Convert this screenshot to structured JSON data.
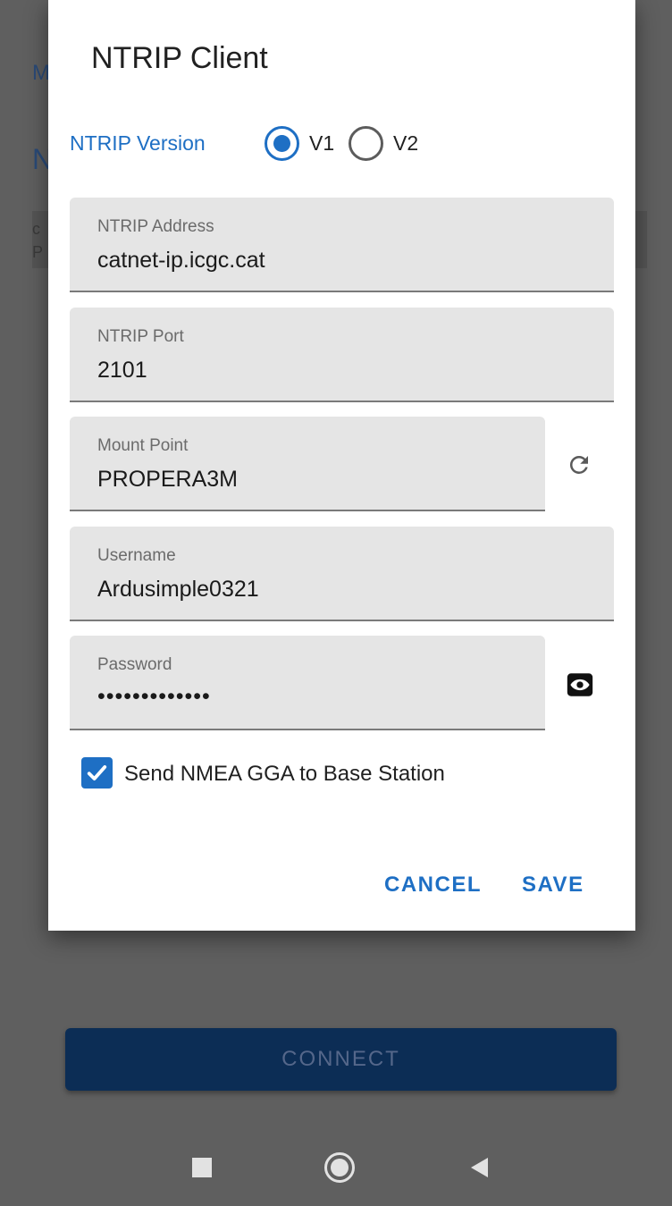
{
  "background": {
    "fragment_m": "M",
    "fragment_n": "N",
    "fragment_c": "c",
    "fragment_p": "P",
    "connect_label": "CONNECT"
  },
  "dialog": {
    "title": "NTRIP Client",
    "version": {
      "label": "NTRIP Version",
      "options": [
        "V1",
        "V2"
      ],
      "selected": "V1"
    },
    "fields": {
      "address": {
        "label": "NTRIP Address",
        "value": "catnet-ip.icgc.cat"
      },
      "port": {
        "label": "NTRIP Port",
        "value": "2101"
      },
      "mountpoint": {
        "label": "Mount Point",
        "value": "PROPERA3M"
      },
      "username": {
        "label": "Username",
        "value": "Ardusimple0321"
      },
      "password": {
        "label": "Password",
        "value": "•••••••••••••"
      }
    },
    "send_gga": {
      "label": "Send NMEA GGA to Base Station",
      "checked": true
    },
    "buttons": {
      "cancel": "CANCEL",
      "save": "SAVE"
    }
  },
  "colors": {
    "accent": "#1e6fc4",
    "connect_button": "#0c2d55",
    "scrim": "#5f5f5f"
  },
  "icons": {
    "mountpoint_action": "refresh-icon",
    "password_action": "eye-icon",
    "nav": [
      "recents-icon",
      "home-icon",
      "back-icon"
    ]
  }
}
